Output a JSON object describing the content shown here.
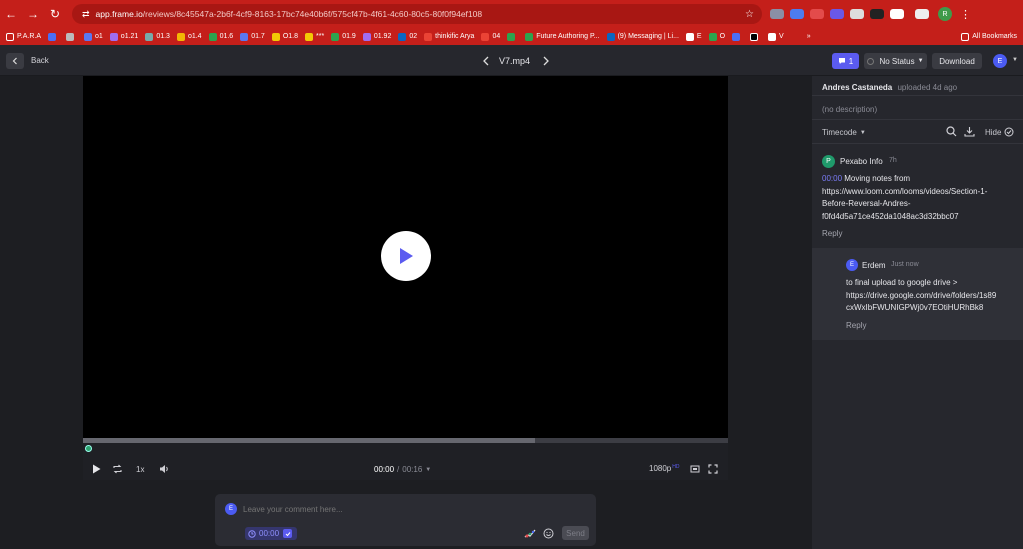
{
  "browser": {
    "url_host": "app.frame.io",
    "url_path": "/reviews/8c45547a-2b6f-4cf9-8163-17bc74e40b6f/575cf47b-4f61-4c60-80c5-80f0f94ef108",
    "bookmarks": [
      "P.A.R.A",
      "o1",
      "o1.21",
      "01.3",
      "o1.4",
      "01.6",
      "01.7",
      "O1.8",
      "***",
      "01.9",
      "01.92",
      "02",
      "thinkific Arya",
      "04",
      "Future Authoring P...",
      "(9) Messaging | Li...",
      "E",
      "O",
      "V"
    ],
    "all_bookmarks": "All Bookmarks",
    "profile_initial": "R"
  },
  "header": {
    "back_label": "Back",
    "filename": "V7.mp4",
    "comment_count": "1",
    "status_label": "No Status",
    "download_label": "Download",
    "user_initial": "E"
  },
  "player": {
    "speed": "1x",
    "time_current": "00:00",
    "time_total": "00:16",
    "quality": "1080p",
    "quality_badge": "HD",
    "progress_fraction": 0.7
  },
  "comment_box": {
    "avatar_initial": "E",
    "placeholder": "Leave your comment here...",
    "timecode": "00:00",
    "send_label": "Send"
  },
  "sidebar": {
    "uploader": "Andres Castaneda",
    "uploaded_meta": "uploaded 4d ago",
    "description": "(no description)",
    "sort_label": "Timecode",
    "hide_label": "Hide",
    "comments": [
      {
        "avatar_initial": "P",
        "avatar_color": "#1f9a6b",
        "author": "Pexabo Info",
        "time": "7h",
        "timecode": "00:00",
        "lines": [
          "Moving notes from",
          "https://www.loom.com/looms/videos/Section-1-",
          "Before-Reversal-Andres-",
          "f0fd4d5a71ce452da1048ac3d32bbc07"
        ],
        "reply_label": "Reply"
      },
      {
        "avatar_initial": "E",
        "avatar_color": "#4b5bf2",
        "author": "Erdem",
        "time": "Just now",
        "lines": [
          "to final upload to google drive >",
          "https://drive.google.com/drive/folders/1s89",
          "cxWxIbFWUNIGPWj0v7EOtiHURhBk8"
        ],
        "reply_label": "Reply"
      }
    ]
  },
  "colors": {
    "accent": "#5b5bf0",
    "brand_red": "#c41f1a"
  }
}
